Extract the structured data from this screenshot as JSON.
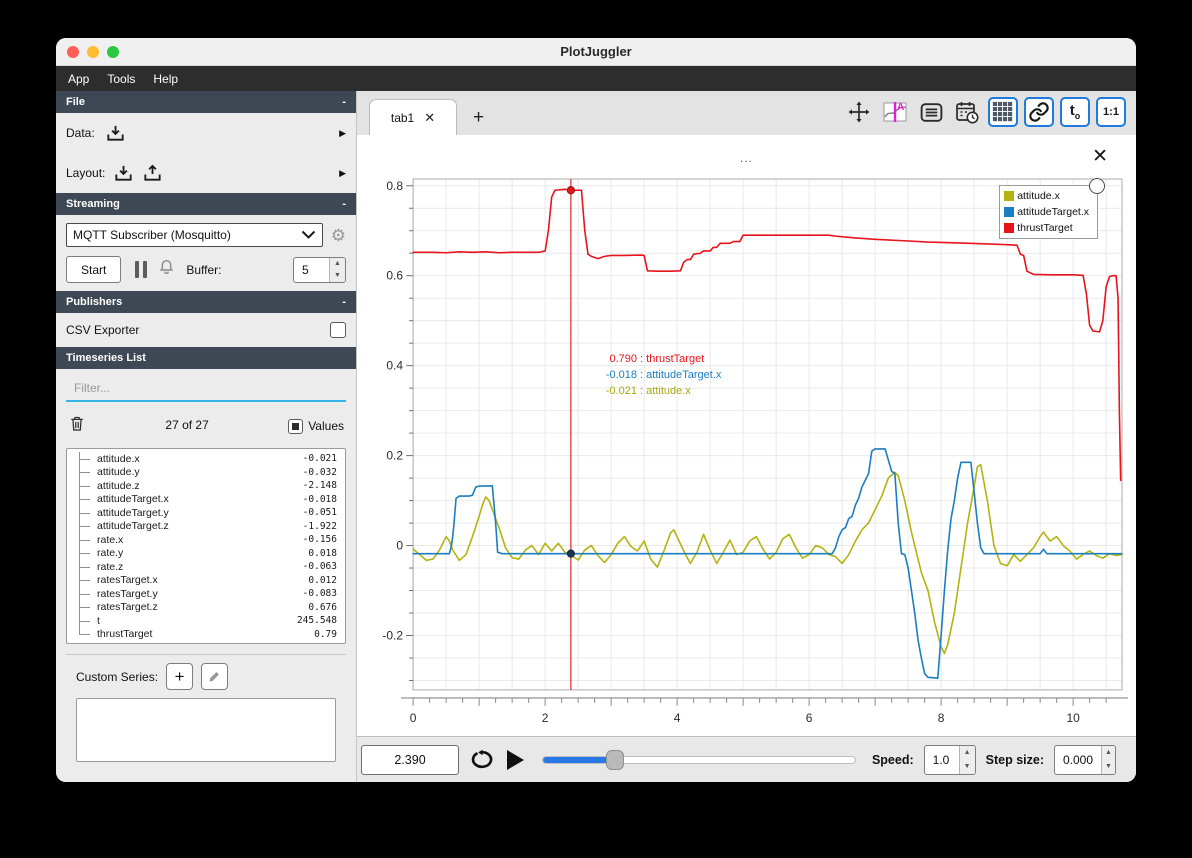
{
  "window": {
    "title": "PlotJuggler",
    "menu": [
      "App",
      "Tools",
      "Help"
    ]
  },
  "glyphs": {
    "collapse": "-",
    "expand_arrow": "▶",
    "add_tab": "+",
    "close": "✕",
    "dots": "...",
    "plus": "+",
    "t0_main": "t",
    "t0_sub": "o",
    "ratio": "1:1"
  },
  "sidebar": {
    "sections": {
      "file": "File",
      "streaming": "Streaming",
      "publishers": "Publishers",
      "timeseries": "Timeseries List"
    },
    "file": {
      "data_label": "Data:",
      "layout_label": "Layout:"
    },
    "streaming": {
      "source": "MQTT Subscriber (Mosquitto)",
      "start_label": "Start",
      "buffer_label": "Buffer:",
      "buffer_value": "5"
    },
    "publishers": {
      "csv_exporter": "CSV Exporter"
    },
    "timeseries": {
      "filter_placeholder": "Filter...",
      "count": "27 of 27",
      "values_label": "Values",
      "items": [
        {
          "name": "attitude.x",
          "value": "-0.021"
        },
        {
          "name": "attitude.y",
          "value": "-0.032"
        },
        {
          "name": "attitude.z",
          "value": "-2.148"
        },
        {
          "name": "attitudeTarget.x",
          "value": "-0.018"
        },
        {
          "name": "attitudeTarget.y",
          "value": "-0.051"
        },
        {
          "name": "attitudeTarget.z",
          "value": "-1.922"
        },
        {
          "name": "rate.x",
          "value": "-0.156"
        },
        {
          "name": "rate.y",
          "value": "0.018"
        },
        {
          "name": "rate.z",
          "value": "-0.063"
        },
        {
          "name": "ratesTarget.x",
          "value": "0.012"
        },
        {
          "name": "ratesTarget.y",
          "value": "-0.083"
        },
        {
          "name": "ratesTarget.z",
          "value": "0.676"
        },
        {
          "name": "t",
          "value": "245.548"
        },
        {
          "name": "thrustTarget",
          "value": "0.79"
        }
      ]
    },
    "custom_series_label": "Custom Series:"
  },
  "tabs": {
    "active": "tab1"
  },
  "controls": {
    "time_value": "2.390",
    "slider_fraction": 0.23,
    "speed_label": "Speed:",
    "speed_value": "1.0",
    "step_label": "Step size:",
    "step_value": "0.000"
  },
  "tracker": {
    "x": 2.39,
    "line_color": "#d22a2a",
    "markers": [
      {
        "x": 2.39,
        "y": 0.79,
        "fill": "#e8141c",
        "stroke": "#8f0f14"
      },
      {
        "x": 2.39,
        "y": -0.018,
        "fill": "#1c3550",
        "stroke": "#10263c"
      }
    ],
    "readouts": [
      {
        "value": "0.790",
        "name": "thrustTarget",
        "color": "#e8141c"
      },
      {
        "value": "-0.018",
        "name": "attitudeTarget.x",
        "color": "#1b7ec2"
      },
      {
        "value": "-0.021",
        "name": "attitude.x",
        "color": "#a9a80f"
      }
    ]
  },
  "chart_data": {
    "type": "line",
    "title": "",
    "xlabel": "",
    "ylabel": "",
    "xlim": [
      0,
      10.74
    ],
    "ylim": [
      -0.321,
      0.815
    ],
    "x_ticks": [
      0,
      2,
      4,
      6,
      8,
      10
    ],
    "y_ticks": [
      -0.2,
      0,
      0.2,
      0.4,
      0.6,
      0.8
    ],
    "grid": {
      "on": true,
      "x_step": 0.5,
      "y_step": 0.05,
      "x_minor_tick": 0.25,
      "y_minor_tick": 0.05
    },
    "legend_position": "top-right",
    "series": [
      {
        "name": "attitude.x",
        "color": "#b4b312",
        "points": [
          [
            0,
            -0.008
          ],
          [
            0.1,
            -0.02
          ],
          [
            0.2,
            -0.033
          ],
          [
            0.3,
            -0.03
          ],
          [
            0.4,
            -0.01
          ],
          [
            0.5,
            0.02
          ],
          [
            0.55,
            0.01
          ],
          [
            0.6,
            -0.01
          ],
          [
            0.7,
            -0.033
          ],
          [
            0.8,
            -0.02
          ],
          [
            0.9,
            0.02
          ],
          [
            1.0,
            0.065
          ],
          [
            1.05,
            0.09
          ],
          [
            1.1,
            0.108
          ],
          [
            1.15,
            0.1
          ],
          [
            1.2,
            0.08
          ],
          [
            1.3,
            0.04
          ],
          [
            1.4,
            -0.005
          ],
          [
            1.5,
            -0.027
          ],
          [
            1.6,
            -0.03
          ],
          [
            1.7,
            -0.01
          ],
          [
            1.8,
            0.0
          ],
          [
            1.9,
            -0.02
          ],
          [
            2.0,
            0.005
          ],
          [
            2.1,
            -0.012
          ],
          [
            2.2,
            0.005
          ],
          [
            2.3,
            -0.015
          ],
          [
            2.39,
            -0.021
          ],
          [
            2.5,
            -0.032
          ],
          [
            2.6,
            -0.01
          ],
          [
            2.7,
            0.0
          ],
          [
            2.8,
            -0.022
          ],
          [
            2.9,
            -0.038
          ],
          [
            3.0,
            -0.02
          ],
          [
            3.1,
            0.005
          ],
          [
            3.2,
            0.02
          ],
          [
            3.3,
            -0.002
          ],
          [
            3.4,
            -0.012
          ],
          [
            3.5,
            0.01
          ],
          [
            3.6,
            -0.03
          ],
          [
            3.7,
            -0.048
          ],
          [
            3.8,
            -0.012
          ],
          [
            3.9,
            0.028
          ],
          [
            3.95,
            0.035
          ],
          [
            4.1,
            -0.012
          ],
          [
            4.2,
            -0.04
          ],
          [
            4.3,
            -0.015
          ],
          [
            4.4,
            0.025
          ],
          [
            4.5,
            -0.01
          ],
          [
            4.6,
            -0.04
          ],
          [
            4.7,
            -0.015
          ],
          [
            4.8,
            0.012
          ],
          [
            4.9,
            -0.02
          ],
          [
            5.0,
            -0.015
          ],
          [
            5.1,
            0.01
          ],
          [
            5.2,
            0.02
          ],
          [
            5.3,
            -0.008
          ],
          [
            5.4,
            -0.03
          ],
          [
            5.5,
            -0.015
          ],
          [
            5.6,
            0.015
          ],
          [
            5.7,
            0.025
          ],
          [
            5.8,
            -0.005
          ],
          [
            5.9,
            -0.028
          ],
          [
            6.0,
            -0.02
          ],
          [
            6.1,
            0.0
          ],
          [
            6.2,
            -0.005
          ],
          [
            6.3,
            -0.02
          ],
          [
            6.4,
            -0.025
          ],
          [
            6.5,
            -0.04
          ],
          [
            6.6,
            -0.02
          ],
          [
            6.7,
            0.01
          ],
          [
            6.8,
            0.035
          ],
          [
            6.9,
            0.05
          ],
          [
            7.0,
            0.08
          ],
          [
            7.1,
            0.11
          ],
          [
            7.2,
            0.15
          ],
          [
            7.3,
            0.163
          ],
          [
            7.35,
            0.155
          ],
          [
            7.45,
            0.1
          ],
          [
            7.55,
            0.03
          ],
          [
            7.6,
            0.0
          ],
          [
            7.7,
            -0.06
          ],
          [
            7.8,
            -0.1
          ],
          [
            7.9,
            -0.17
          ],
          [
            8.0,
            -0.225
          ],
          [
            8.05,
            -0.24
          ],
          [
            8.1,
            -0.22
          ],
          [
            8.2,
            -0.15
          ],
          [
            8.3,
            -0.05
          ],
          [
            8.4,
            0.05
          ],
          [
            8.5,
            0.13
          ],
          [
            8.55,
            0.175
          ],
          [
            8.6,
            0.18
          ],
          [
            8.7,
            0.1
          ],
          [
            8.8,
            0.0
          ],
          [
            8.9,
            -0.04
          ],
          [
            9.0,
            -0.045
          ],
          [
            9.1,
            -0.02
          ],
          [
            9.2,
            -0.035
          ],
          [
            9.3,
            -0.02
          ],
          [
            9.4,
            -0.005
          ],
          [
            9.5,
            0.02
          ],
          [
            9.55,
            0.03
          ],
          [
            9.65,
            0.01
          ],
          [
            9.75,
            0.02
          ],
          [
            9.85,
            0.0
          ],
          [
            9.95,
            -0.012
          ],
          [
            10.05,
            -0.03
          ],
          [
            10.15,
            -0.02
          ],
          [
            10.25,
            -0.012
          ],
          [
            10.35,
            -0.022
          ],
          [
            10.45,
            -0.028
          ],
          [
            10.55,
            -0.018
          ],
          [
            10.65,
            -0.022
          ],
          [
            10.74,
            -0.02
          ]
        ]
      },
      {
        "name": "attitudeTarget.x",
        "color": "#1b7ec2",
        "points": [
          [
            0,
            -0.018
          ],
          [
            0.55,
            -0.018
          ],
          [
            0.58,
            0.0
          ],
          [
            0.6,
            0.02
          ],
          [
            0.62,
            0.05
          ],
          [
            0.65,
            0.105
          ],
          [
            0.7,
            0.11
          ],
          [
            0.85,
            0.11
          ],
          [
            0.9,
            0.112
          ],
          [
            0.95,
            0.13
          ],
          [
            1.0,
            0.132
          ],
          [
            1.2,
            0.133
          ],
          [
            1.25,
            0.05
          ],
          [
            1.28,
            -0.015
          ],
          [
            1.35,
            -0.018
          ],
          [
            2.5,
            -0.018
          ],
          [
            4.0,
            -0.018
          ],
          [
            5.5,
            -0.018
          ],
          [
            6.35,
            -0.018
          ],
          [
            6.4,
            -0.005
          ],
          [
            6.45,
            0.02
          ],
          [
            6.5,
            0.035
          ],
          [
            6.55,
            0.04
          ],
          [
            6.6,
            0.06
          ],
          [
            6.65,
            0.065
          ],
          [
            6.7,
            0.09
          ],
          [
            6.75,
            0.105
          ],
          [
            6.8,
            0.13
          ],
          [
            6.85,
            0.145
          ],
          [
            6.9,
            0.16
          ],
          [
            6.95,
            0.21
          ],
          [
            7.0,
            0.215
          ],
          [
            7.15,
            0.215
          ],
          [
            7.2,
            0.19
          ],
          [
            7.25,
            0.165
          ],
          [
            7.3,
            0.16
          ],
          [
            7.35,
            0.05
          ],
          [
            7.4,
            -0.018
          ],
          [
            7.45,
            -0.02
          ],
          [
            7.5,
            -0.05
          ],
          [
            7.55,
            -0.1
          ],
          [
            7.6,
            -0.15
          ],
          [
            7.65,
            -0.21
          ],
          [
            7.7,
            -0.25
          ],
          [
            7.75,
            -0.285
          ],
          [
            7.8,
            -0.293
          ],
          [
            7.95,
            -0.295
          ],
          [
            8.0,
            -0.2
          ],
          [
            8.05,
            -0.1
          ],
          [
            8.1,
            -0.01
          ],
          [
            8.15,
            0.06
          ],
          [
            8.2,
            0.1
          ],
          [
            8.25,
            0.15
          ],
          [
            8.3,
            0.185
          ],
          [
            8.45,
            0.185
          ],
          [
            8.5,
            0.12
          ],
          [
            8.55,
            0.05
          ],
          [
            8.6,
            -0.005
          ],
          [
            8.65,
            -0.018
          ],
          [
            9.5,
            -0.018
          ],
          [
            9.55,
            -0.008
          ],
          [
            9.6,
            -0.018
          ],
          [
            10.74,
            -0.018
          ]
        ]
      },
      {
        "name": "thrustTarget",
        "color": "#e8141c",
        "points": [
          [
            0,
            0.652
          ],
          [
            0.3,
            0.652
          ],
          [
            0.5,
            0.651
          ],
          [
            0.7,
            0.653
          ],
          [
            0.9,
            0.652
          ],
          [
            1.1,
            0.653
          ],
          [
            1.3,
            0.651
          ],
          [
            1.5,
            0.652
          ],
          [
            1.9,
            0.652
          ],
          [
            2.0,
            0.655
          ],
          [
            2.05,
            0.7
          ],
          [
            2.1,
            0.775
          ],
          [
            2.15,
            0.79
          ],
          [
            2.3,
            0.792
          ],
          [
            2.45,
            0.79
          ],
          [
            2.55,
            0.79
          ],
          [
            2.6,
            0.7
          ],
          [
            2.65,
            0.648
          ],
          [
            2.7,
            0.643
          ],
          [
            2.8,
            0.638
          ],
          [
            2.9,
            0.643
          ],
          [
            3.0,
            0.645
          ],
          [
            3.2,
            0.645
          ],
          [
            3.45,
            0.646
          ],
          [
            3.5,
            0.645
          ],
          [
            3.55,
            0.611
          ],
          [
            3.7,
            0.61
          ],
          [
            3.9,
            0.61
          ],
          [
            4.05,
            0.611
          ],
          [
            4.1,
            0.63
          ],
          [
            4.15,
            0.636
          ],
          [
            4.2,
            0.636
          ],
          [
            4.25,
            0.648
          ],
          [
            4.35,
            0.65
          ],
          [
            4.4,
            0.655
          ],
          [
            4.5,
            0.655
          ],
          [
            4.55,
            0.663
          ],
          [
            4.6,
            0.663
          ],
          [
            4.65,
            0.672
          ],
          [
            4.8,
            0.672
          ],
          [
            4.85,
            0.676
          ],
          [
            4.95,
            0.676
          ],
          [
            5.0,
            0.69
          ],
          [
            5.5,
            0.69
          ],
          [
            6.0,
            0.69
          ],
          [
            6.3,
            0.69
          ],
          [
            6.4,
            0.688
          ],
          [
            6.7,
            0.684
          ],
          [
            7.0,
            0.681
          ],
          [
            7.4,
            0.678
          ],
          [
            7.8,
            0.675
          ],
          [
            8.2,
            0.673
          ],
          [
            8.6,
            0.671
          ],
          [
            9.0,
            0.669
          ],
          [
            9.15,
            0.668
          ],
          [
            9.2,
            0.648
          ],
          [
            9.25,
            0.645
          ],
          [
            9.3,
            0.61
          ],
          [
            9.4,
            0.603
          ],
          [
            9.7,
            0.602
          ],
          [
            10.0,
            0.602
          ],
          [
            10.15,
            0.601
          ],
          [
            10.2,
            0.56
          ],
          [
            10.25,
            0.49
          ],
          [
            10.3,
            0.477
          ],
          [
            10.4,
            0.475
          ],
          [
            10.45,
            0.5
          ],
          [
            10.5,
            0.575
          ],
          [
            10.55,
            0.598
          ],
          [
            10.6,
            0.6
          ],
          [
            10.65,
            0.6
          ],
          [
            10.68,
            0.55
          ],
          [
            10.7,
            0.3
          ],
          [
            10.72,
            0.145
          ]
        ]
      }
    ]
  }
}
